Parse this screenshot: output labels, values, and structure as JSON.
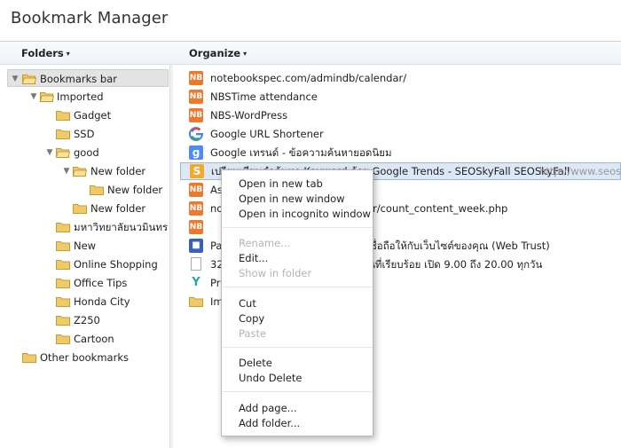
{
  "app": {
    "title": "Bookmark Manager"
  },
  "header": {
    "folders_label": "Folders",
    "organize_label": "Organize",
    "caret": "▾"
  },
  "tree": [
    {
      "label": "Bookmarks bar",
      "selected": true,
      "expanded": true
    },
    {
      "label": "Imported",
      "expanded": true
    },
    {
      "label": "Gadget"
    },
    {
      "label": "SSD"
    },
    {
      "label": "good",
      "expanded": true
    },
    {
      "label": "New folder",
      "expanded": true
    },
    {
      "label": "New folder"
    },
    {
      "label": "New folder"
    },
    {
      "label": "มหาวิทยาลัยนวมินทราธิ"
    },
    {
      "label": "New"
    },
    {
      "label": "Online Shopping"
    },
    {
      "label": "Office Tips"
    },
    {
      "label": "Honda City"
    },
    {
      "label": "Z250"
    },
    {
      "label": "Cartoon"
    },
    {
      "label": "Other bookmarks"
    }
  ],
  "items": [
    {
      "icon": "nb-favicon",
      "label": "notebookspec.com/admindb/calendar/"
    },
    {
      "icon": "nb-favicon",
      "label": "NBSTime attendance"
    },
    {
      "icon": "nb-favicon",
      "label": "NBS-WordPress"
    },
    {
      "icon": "google-favicon",
      "label": "Google URL Shortener"
    },
    {
      "icon": "google-plus-favicon",
      "label": "Google เทรนด์ - ข้อความค้นหายอดนิยม"
    },
    {
      "icon": "seoskyfall-favicon",
      "label": "เปรียบเทียบคำค้นหา Keyword ด้วย Google Trends - SEOSkyFall SEOSkyFall",
      "url": "http://www.seosky",
      "selected": true
    },
    {
      "icon": "nb-favicon",
      "label": "Asr"
    },
    {
      "icon": "nb-favicon",
      "label": "not",
      "tail": "r/count_content_week.php"
    },
    {
      "icon": "nb-favicon",
      "label": ""
    },
    {
      "icon": "blue-square-favicon",
      "label": "Paw",
      "tail": "ชื่อถือให้กับเว็บไซต์ของคุณ (Web Trust)"
    },
    {
      "icon": "page-favicon",
      "label": "320",
      "tail": "นที่เรียบร้อย เปิด 9.00 ถึง 20.00 ทุกวัน"
    },
    {
      "icon": "y-favicon",
      "label": "Pro"
    },
    {
      "icon": "folder-icon",
      "label": "Imp"
    }
  ],
  "context_menu": {
    "items": [
      {
        "label": "Open in new tab",
        "enabled": true
      },
      {
        "label": "Open in new window",
        "enabled": true
      },
      {
        "label": "Open in incognito window",
        "enabled": true
      },
      {
        "label": "Rename...",
        "enabled": false
      },
      {
        "label": "Edit...",
        "enabled": true
      },
      {
        "label": "Show in folder",
        "enabled": false
      },
      {
        "label": "Cut",
        "enabled": true
      },
      {
        "label": "Copy",
        "enabled": true
      },
      {
        "label": "Paste",
        "enabled": false
      },
      {
        "label": "Delete",
        "enabled": true
      },
      {
        "label": "Undo Delete",
        "enabled": true
      },
      {
        "label": "Add page...",
        "enabled": true
      },
      {
        "label": "Add folder...",
        "enabled": true
      }
    ]
  },
  "colors": {
    "folder": "#f2c969",
    "folder_edge": "#c99a2e",
    "accent": "#9eb7da"
  }
}
